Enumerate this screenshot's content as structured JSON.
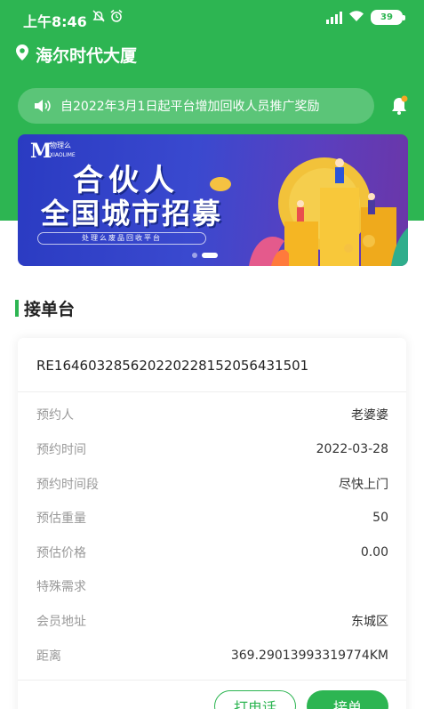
{
  "status_bar": {
    "time": "上午8:46",
    "battery": "39"
  },
  "location": {
    "name": "海尔时代大厦"
  },
  "notice": {
    "text": "自2022年3月1日起平台增加回收人员推广奖励"
  },
  "banner": {
    "brand": "物理么",
    "brand_sub": "XIAOLIME",
    "title_line1": "合伙人",
    "title_line2": "全国城市招募",
    "subtitle": "处理么废品回收平台"
  },
  "section": {
    "title": "接单台"
  },
  "order": {
    "order_no": "RE16460328562022022815205643150​1",
    "fields": [
      {
        "label": "预约人",
        "value": "老婆婆"
      },
      {
        "label": "预约时间",
        "value": "2022-03-28"
      },
      {
        "label": "预约时间段",
        "value": "尽快上门"
      },
      {
        "label": "预估重量",
        "value": "50"
      },
      {
        "label": "预估价格",
        "value": "0.00"
      },
      {
        "label": "特殊需求",
        "value": ""
      },
      {
        "label": "会员地址",
        "value": "东城区"
      },
      {
        "label": "距离",
        "value": "369.29013993319774KM"
      }
    ],
    "call_label": "打电话",
    "accept_label": "接单"
  },
  "colors": {
    "primary": "#2db552",
    "banner": "#3a49cf"
  }
}
